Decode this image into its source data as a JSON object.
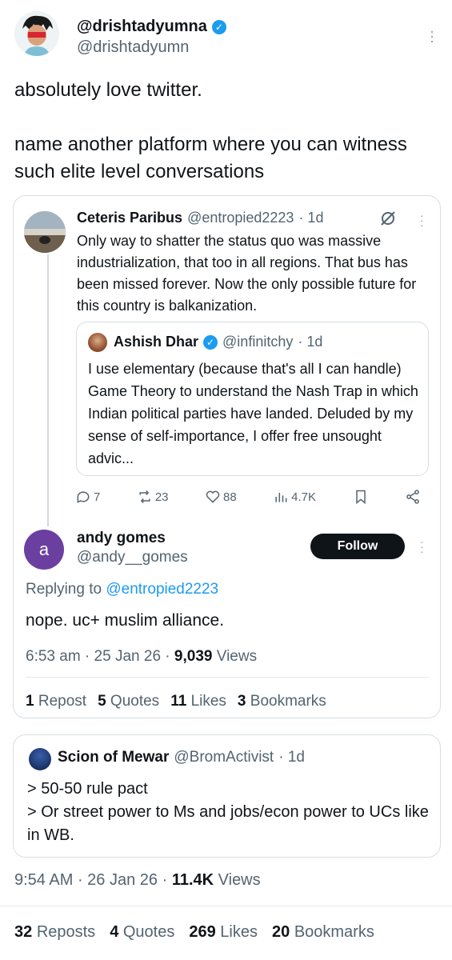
{
  "header": {
    "display_name": "@drishtadyumna",
    "handle": "@drishtadyumn",
    "verified": true
  },
  "main_tweet": {
    "text_line1": "absolutely love twitter.",
    "text_line2": "name another platform where you can witness such elite level conversations",
    "time": "9:54 AM",
    "date": "26 Jan 26",
    "views_count": "11.4K",
    "views_label": "Views",
    "stats": {
      "reposts_count": "32",
      "reposts_label": "Reposts",
      "quotes_count": "4",
      "quotes_label": "Quotes",
      "likes_count": "269",
      "likes_label": "Likes",
      "bookmarks_count": "20",
      "bookmarks_label": "Bookmarks"
    }
  },
  "embedded_thread": {
    "parent": {
      "name": "Ceteris Paribus",
      "handle": "@entropied2223",
      "time": "· 1d",
      "text": "Only way to shatter the status quo was massive industrialization, that too in all regions. That bus has been missed forever. Now the only possible future for this country is balkanization.",
      "quoted": {
        "name": "Ashish Dhar",
        "handle": "@infinitchy",
        "time": "· 1d",
        "text": "I use elementary (because that's all I can handle) Game Theory to understand the Nash Trap in which Indian political parties have landed. Deluded by my sense of self-importance, I offer free unsought advic..."
      },
      "actions": {
        "replies": "7",
        "reposts": "23",
        "likes": "88",
        "views": "4.7K"
      }
    },
    "reply": {
      "avatar_letter": "a",
      "name": "andy gomes",
      "handle": "@andy__gomes",
      "follow_label": "Follow",
      "replying_prefix": "Replying to",
      "replying_to": "@entropied2223",
      "text": "nope. uc+ muslim alliance.",
      "time": "6:53 am",
      "date": "25 Jan 26",
      "views_count": "9,039",
      "views_label": "Views",
      "stats": {
        "reposts_count": "1",
        "reposts_label": "Repost",
        "quotes_count": "5",
        "quotes_label": "Quotes",
        "likes_count": "11",
        "likes_label": "Likes",
        "bookmarks_count": "3",
        "bookmarks_label": "Bookmarks"
      }
    }
  },
  "quoted_reply": {
    "name": "Scion of Mewar",
    "handle": "@BromActivist",
    "time": "· 1d",
    "line1": "> 50-50 rule pact",
    "line2": "> Or street power to Ms and jobs/econ power to UCs like in WB."
  },
  "colors": {
    "text": "#0f1419",
    "secondary": "#536471",
    "link": "#1d9bf0",
    "border": "#d7dee3"
  }
}
